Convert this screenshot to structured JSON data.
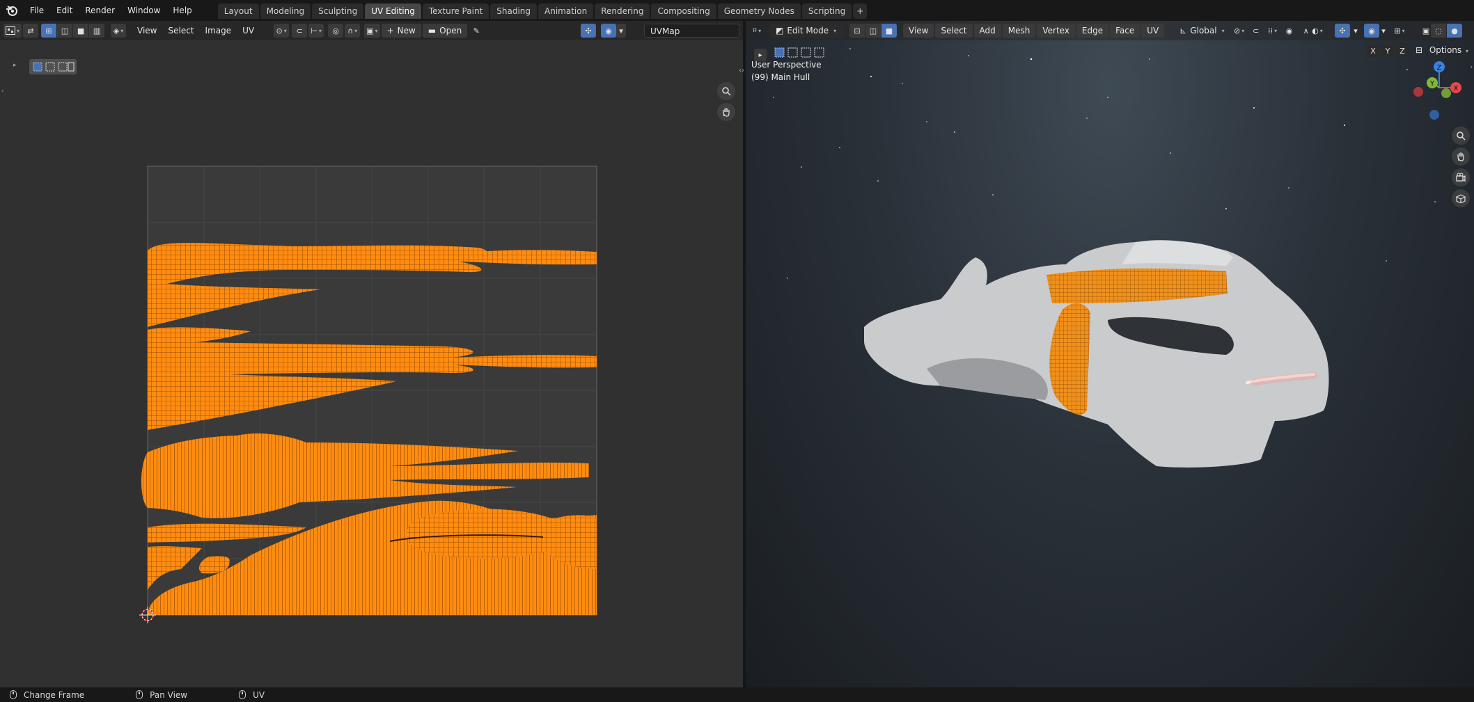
{
  "topbar": {
    "menus": [
      "File",
      "Edit",
      "Render",
      "Window",
      "Help"
    ],
    "workspaces": [
      "Layout",
      "Modeling",
      "Sculpting",
      "UV Editing",
      "Texture Paint",
      "Shading",
      "Animation",
      "Rendering",
      "Compositing",
      "Geometry Nodes",
      "Scripting"
    ],
    "active_workspace": "UV Editing",
    "add_label": "+"
  },
  "uv_editor": {
    "menus": [
      "View",
      "Select",
      "Image",
      "UV"
    ],
    "new_label": "New",
    "open_label": "Open",
    "uvmap_value": "UVMap",
    "uv_color": "#ff8c10"
  },
  "viewport": {
    "mode_label": "Edit Mode",
    "menus": [
      "View",
      "Select",
      "Add",
      "Mesh",
      "Vertex",
      "Edge",
      "Face",
      "UV"
    ],
    "orientation_label": "Global",
    "options_label": "Options",
    "axis_buttons": [
      "X",
      "Y",
      "Z"
    ],
    "perspective_label": "User Perspective",
    "object_label": "(99) Main Hull",
    "gizmo_axes": {
      "x": "X",
      "y": "Y",
      "z": "Z"
    },
    "axis_colors": {
      "x": "#e5484d",
      "y": "#7fb83a",
      "z": "#3b82e0"
    }
  },
  "statusbar": {
    "items": [
      "Change Frame",
      "Pan View",
      "UV"
    ]
  }
}
